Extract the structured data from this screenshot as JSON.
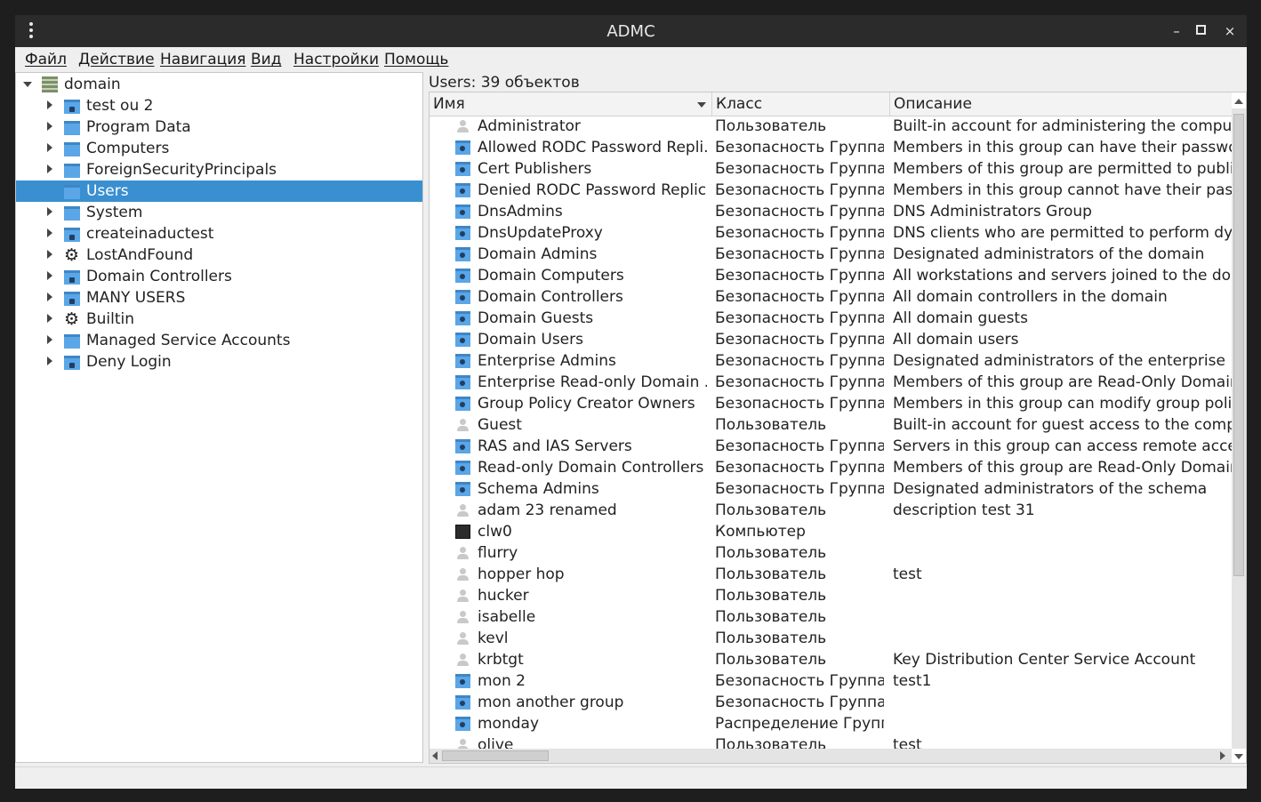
{
  "window": {
    "title": "ADMC",
    "minimize": "–",
    "maximize": "□",
    "close": "×"
  },
  "menu": [
    "Файл",
    "Действие",
    "Навигация",
    "Вид",
    "Настройки",
    "Помощь"
  ],
  "tree": [
    {
      "label": "domain",
      "icon": "domain-icon",
      "expanded": true
    },
    {
      "label": "test ou 2",
      "icon": "ou-folder-icon"
    },
    {
      "label": "Program Data",
      "icon": "folder-icon"
    },
    {
      "label": "Computers",
      "icon": "folder-icon"
    },
    {
      "label": "ForeignSecurityPrincipals",
      "icon": "folder-icon"
    },
    {
      "label": "Users",
      "icon": "folder-icon",
      "selected": true
    },
    {
      "label": "System",
      "icon": "folder-icon"
    },
    {
      "label": "createinaductest",
      "icon": "ou-folder-icon"
    },
    {
      "label": "LostAndFound",
      "icon": "gear-icon"
    },
    {
      "label": "Domain Controllers",
      "icon": "ou-folder-icon"
    },
    {
      "label": "MANY USERS",
      "icon": "ou-folder-icon"
    },
    {
      "label": "Builtin",
      "icon": "gear-icon"
    },
    {
      "label": "Managed Service Accounts",
      "icon": "folder-icon"
    },
    {
      "label": "Deny Login",
      "icon": "ou-folder-icon"
    }
  ],
  "content": {
    "header_label": "Users: 39 объектов",
    "columns": [
      "Имя",
      "Класс",
      "Описание"
    ],
    "rows": [
      {
        "icon": "user",
        "name": "Administrator",
        "class": "Пользователь",
        "desc": "Built-in account for administering the computer"
      },
      {
        "icon": "group",
        "name": "Allowed RODC Password Repli...",
        "class": "Безопасность Группа ...",
        "desc": "Members in this group can have their passwords"
      },
      {
        "icon": "group",
        "name": "Cert Publishers",
        "class": "Безопасность Группа ...",
        "desc": "Members of this group are permitted to publish"
      },
      {
        "icon": "group",
        "name": "Denied RODC Password Replic...",
        "class": "Безопасность Группа ...",
        "desc": "Members in this group cannot have their passwo"
      },
      {
        "icon": "group",
        "name": "DnsAdmins",
        "class": "Безопасность Группа ...",
        "desc": "DNS Administrators Group"
      },
      {
        "icon": "group",
        "name": "DnsUpdateProxy",
        "class": "Безопасность Группа ...",
        "desc": "DNS clients who are permitted to perform dynai"
      },
      {
        "icon": "group",
        "name": "Domain Admins",
        "class": "Безопасность Группа ...",
        "desc": "Designated administrators of the domain"
      },
      {
        "icon": "group",
        "name": "Domain Computers",
        "class": "Безопасность Группа ...",
        "desc": "All workstations and servers joined to the domai"
      },
      {
        "icon": "group",
        "name": "Domain Controllers",
        "class": "Безопасность Группа ...",
        "desc": "All domain controllers in the domain"
      },
      {
        "icon": "group",
        "name": "Domain Guests",
        "class": "Безопасность Группа ...",
        "desc": "All domain guests"
      },
      {
        "icon": "group",
        "name": "Domain Users",
        "class": "Безопасность Группа ...",
        "desc": "All domain users"
      },
      {
        "icon": "group",
        "name": "Enterprise Admins",
        "class": "Безопасность Группа ...",
        "desc": "Designated administrators of the enterprise"
      },
      {
        "icon": "group",
        "name": "Enterprise Read-only Domain ...",
        "class": "Безопасность Группа ...",
        "desc": "Members of this group are Read-Only Domain C"
      },
      {
        "icon": "group",
        "name": "Group Policy Creator Owners",
        "class": "Безопасность Группа ...",
        "desc": "Members in this group can modify group policy f"
      },
      {
        "icon": "user",
        "name": "Guest",
        "class": "Пользователь",
        "desc": "Built-in account for guest access to the compute"
      },
      {
        "icon": "group",
        "name": "RAS and IAS Servers",
        "class": "Безопасность Группа ...",
        "desc": "Servers in this group can access remote access p"
      },
      {
        "icon": "group",
        "name": "Read-only Domain Controllers",
        "class": "Безопасность Группа ...",
        "desc": "Members of this group are Read-Only Domain C"
      },
      {
        "icon": "group",
        "name": "Schema Admins",
        "class": "Безопасность Группа ...",
        "desc": "Designated administrators of the schema"
      },
      {
        "icon": "user",
        "name": "adam 23 renamed",
        "class": "Пользователь",
        "desc": "description test 31"
      },
      {
        "icon": "computer",
        "name": "clw0",
        "class": "Компьютер",
        "desc": ""
      },
      {
        "icon": "user",
        "name": "flurry",
        "class": "Пользователь",
        "desc": ""
      },
      {
        "icon": "user",
        "name": "hopper hop",
        "class": "Пользователь",
        "desc": "test"
      },
      {
        "icon": "user",
        "name": "hucker",
        "class": "Пользователь",
        "desc": ""
      },
      {
        "icon": "user",
        "name": "isabelle",
        "class": "Пользователь",
        "desc": ""
      },
      {
        "icon": "user",
        "name": "kevl",
        "class": "Пользователь",
        "desc": ""
      },
      {
        "icon": "user",
        "name": "krbtgt",
        "class": "Пользователь",
        "desc": "Key Distribution Center Service Account"
      },
      {
        "icon": "group",
        "name": "mon 2",
        "class": "Безопасность Группа ...",
        "desc": "test1"
      },
      {
        "icon": "group",
        "name": "mon another group",
        "class": "Безопасность Группа ...",
        "desc": ""
      },
      {
        "icon": "group",
        "name": "monday",
        "class": "Распределение Групп...",
        "desc": ""
      },
      {
        "icon": "user",
        "name": "olive",
        "class": "Пользователь",
        "desc": "test"
      }
    ]
  }
}
